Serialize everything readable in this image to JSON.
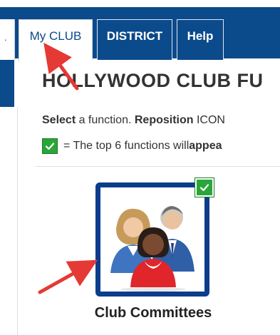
{
  "nav": {
    "tabs": [
      {
        "label": "My CLUB",
        "active": true
      },
      {
        "label": "DISTRICT",
        "active": false
      },
      {
        "label": "Help",
        "active": false
      }
    ]
  },
  "main": {
    "title": "HOLLYWOOD CLUB FU",
    "instruction": {
      "bold1": "Select",
      "text1": " a function. ",
      "bold2": "Reposition",
      "text2": " ICON"
    },
    "legend": {
      "text": " = The top 6 functions will ",
      "bold": "appea"
    },
    "tile": {
      "label": "Club Committees",
      "icon": "people-group-icon",
      "checked": true
    }
  },
  "colors": {
    "brand_blue": "#0b4a8b",
    "tile_border": "#0b3d8c",
    "check_green": "#2aa53a",
    "arrow_red": "#e53935"
  }
}
